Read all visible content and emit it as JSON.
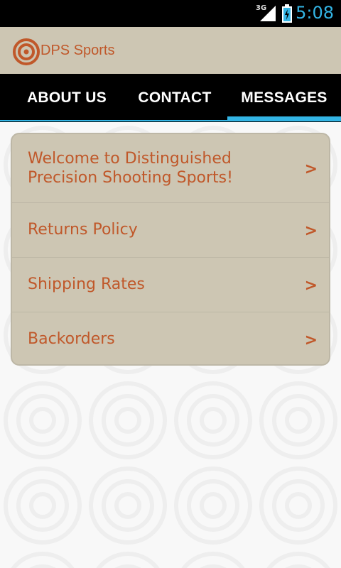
{
  "status_bar": {
    "network": "3G",
    "time": "5:08",
    "signal_icon": "signal-icon",
    "battery_icon": "battery-charging-icon"
  },
  "header": {
    "app_title": "DPS Sports",
    "logo_icon": "target-logo-icon",
    "background_color": "#cdc6b3",
    "brand_color": "#c0582a"
  },
  "tabs": [
    {
      "label": "ABOUT US"
    },
    {
      "label": "CONTACT"
    },
    {
      "label": "MESSAGES",
      "selected": true
    }
  ],
  "accent_color": "#33b5e5",
  "messages": {
    "items": [
      {
        "label": "Welcome to Distinguished Precision Shooting Sports!",
        "chevron": ">"
      },
      {
        "label": "Returns Policy",
        "chevron": ">"
      },
      {
        "label": "Shipping Rates",
        "chevron": ">"
      },
      {
        "label": "Backorders",
        "chevron": ">"
      }
    ]
  }
}
